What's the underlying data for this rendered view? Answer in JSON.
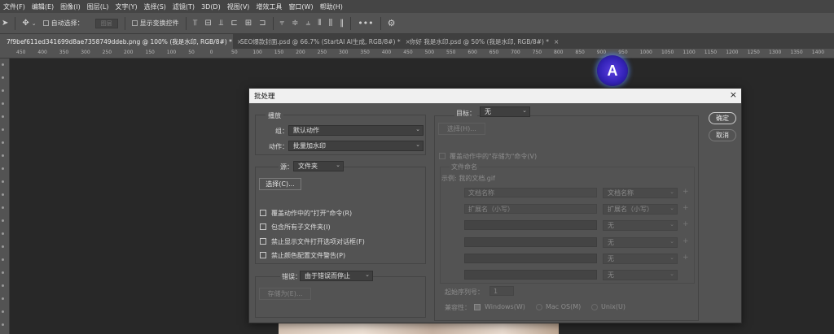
{
  "menu": [
    "文件(F)",
    "编辑(E)",
    "图像(I)",
    "图层(L)",
    "文字(Y)",
    "选择(S)",
    "滤镜(T)",
    "3D(D)",
    "视图(V)",
    "增效工具",
    "窗口(W)",
    "帮助(H)"
  ],
  "options": {
    "auto_select_label": "自动选择：",
    "auto_select_value": "图层",
    "show_transform_label": "显示变换控件"
  },
  "tabs": [
    {
      "label": "7f9bef611ed341699d8ae7358749ddeb.png @ 100% (我是水印, RGB/8#) *",
      "close": "×"
    },
    {
      "label": "SEO爆款封面.psd @ 66.7% (StartAI AI生成, RGB/8#) *",
      "close": "×"
    },
    {
      "label": "你好 我是水印.psd @ 50% (我是水印, RGB/8#) *",
      "close": "×"
    }
  ],
  "ruler_ticks": [
    "450",
    "400",
    "350",
    "300",
    "250",
    "200",
    "150",
    "100",
    "50",
    "0",
    "50",
    "100",
    "150",
    "200",
    "250",
    "300",
    "350",
    "400",
    "450",
    "500",
    "550",
    "600",
    "650",
    "700",
    "750",
    "800",
    "850",
    "900",
    "950",
    "1000",
    "1050",
    "1100",
    "1150",
    "1200",
    "1250",
    "1300",
    "1350",
    "1400",
    "1450"
  ],
  "logo_letter": "A",
  "dialog": {
    "title": "批处理",
    "close": "×",
    "ok_label": "确定",
    "cancel_label": "取消",
    "play": {
      "legend": "播放",
      "group_label": "组：",
      "group_value": "默认动作",
      "action_label": "动作：",
      "action_value": "批量加水印"
    },
    "source": {
      "label": "源：",
      "value": "文件夹",
      "choose_label": "选择(C)...",
      "checkboxes": [
        "覆盖动作中的\"打开\"命令(R)",
        "包含所有子文件夹(I)",
        "禁止显示文件打开选项对话框(F)",
        "禁止颜色配置文件警告(P)"
      ]
    },
    "errors": {
      "label": "错误：",
      "value": "由于错误而停止",
      "save_as_label": "存储为(E)..."
    },
    "target": {
      "label": "目标：",
      "value": "无",
      "choose_label": "选择(H)...",
      "override_save": "覆盖动作中的\"存储为\"命令(V)",
      "naming_legend": "文件命名",
      "example": "示例: 我的文档.gif",
      "rows": [
        {
          "field": "文档名称",
          "select": "文档名称"
        },
        {
          "field": "扩展名（小写）",
          "select": "扩展名（小写）"
        },
        {
          "field": "",
          "select": "无"
        },
        {
          "field": "",
          "select": "无"
        },
        {
          "field": "",
          "select": "无"
        },
        {
          "field": "",
          "select": "无"
        }
      ],
      "plus": "+",
      "serial_label": "起始序列号：",
      "serial_value": "1",
      "compat_label": "兼容性：",
      "compat_options": [
        "Windows(W)",
        "Mac OS(M)",
        "Unix(U)"
      ]
    }
  },
  "colors": {
    "workspace": "#282828",
    "panel": "#535353",
    "menubar": "#454545",
    "logo_blue": "#3423b8"
  }
}
